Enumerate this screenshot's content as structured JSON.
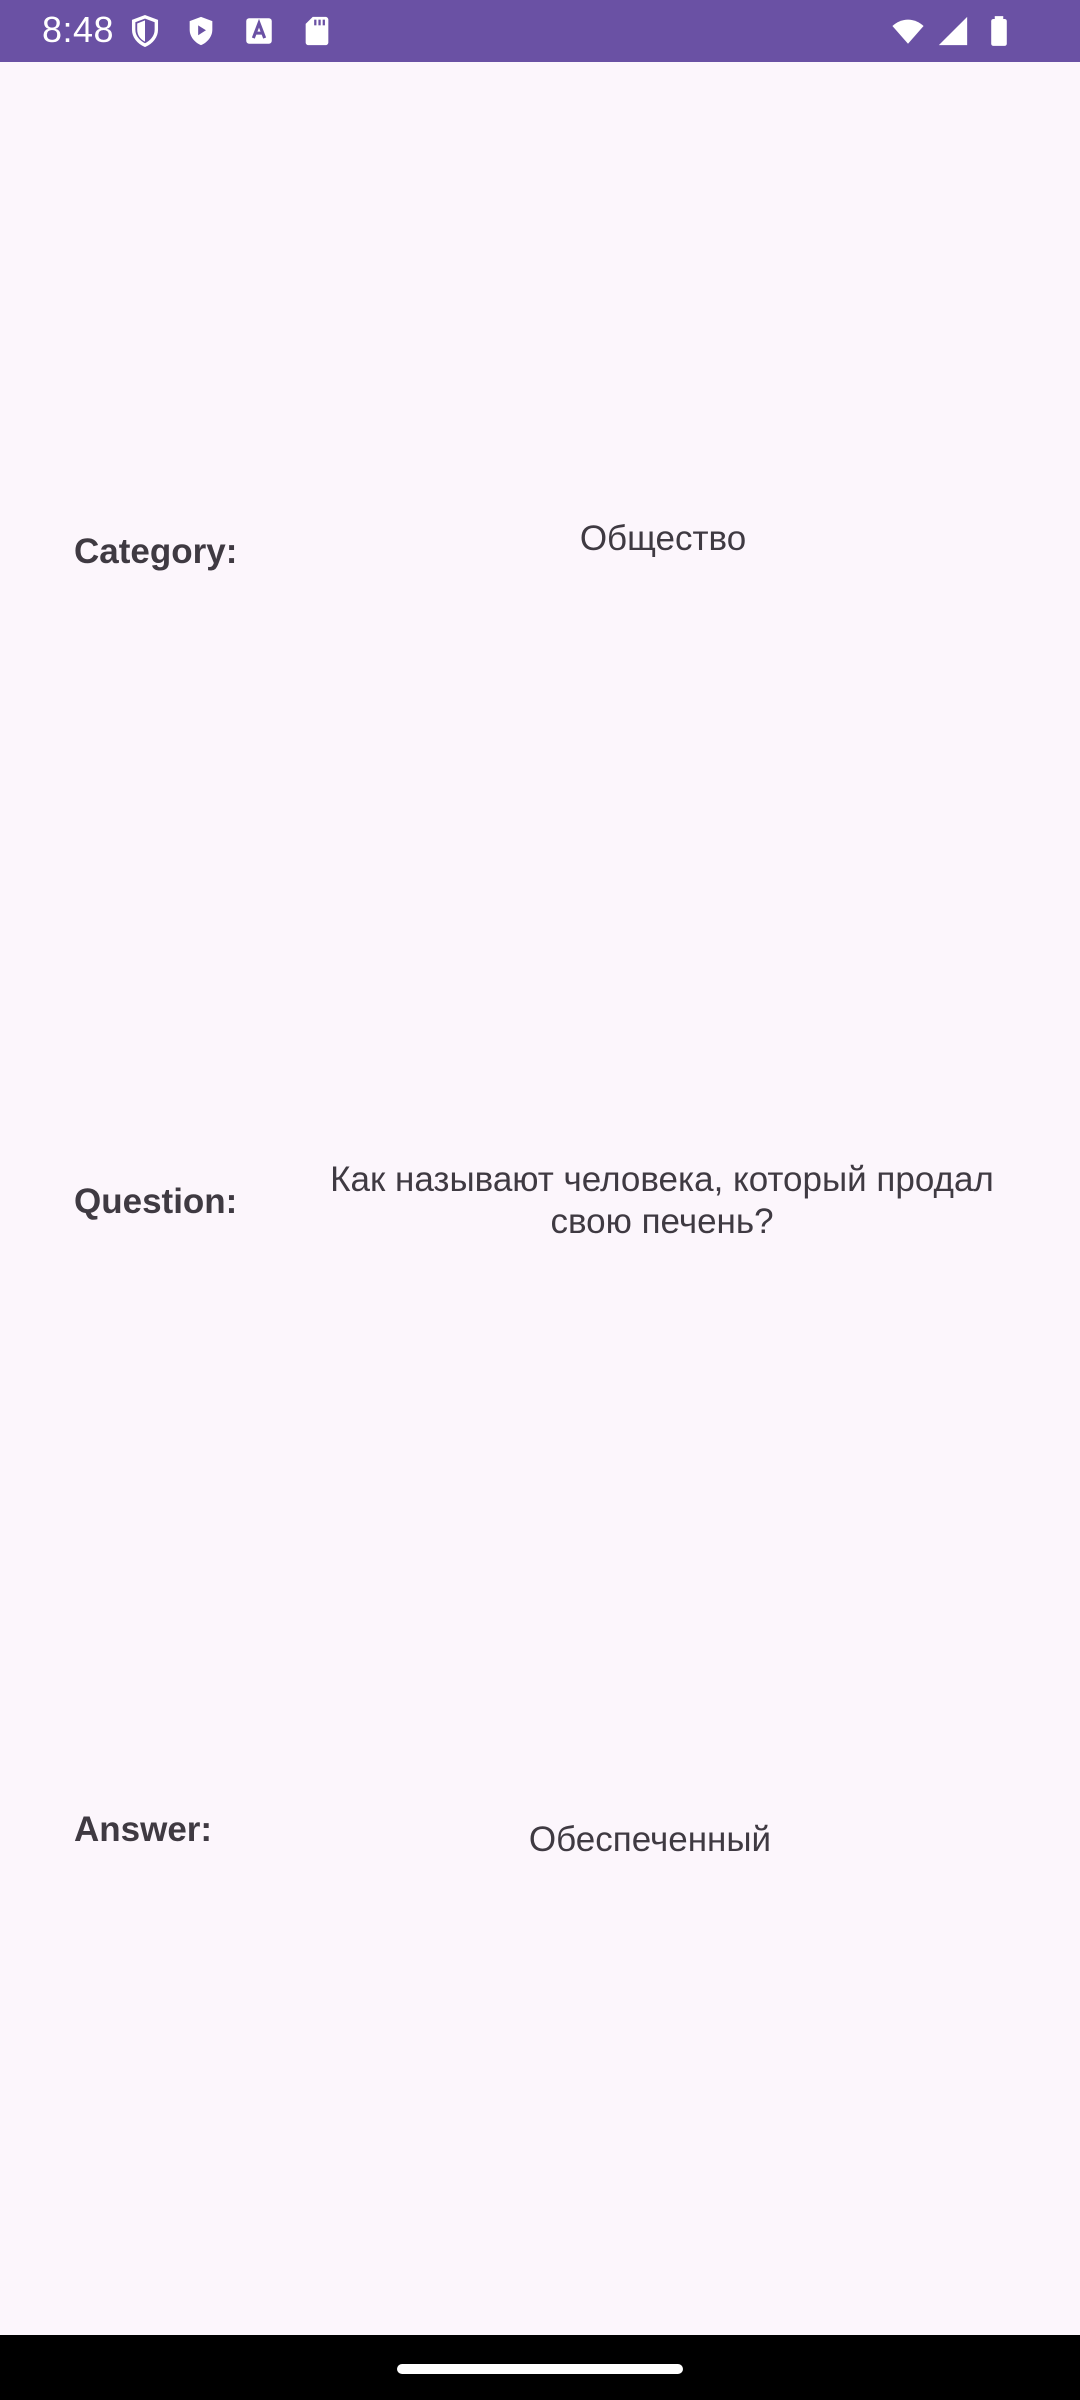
{
  "status_bar": {
    "time": "8:48",
    "left_icons": [
      "shield-icon",
      "play-protect-icon",
      "font-a-icon",
      "sd-card-icon"
    ],
    "right_icons": [
      "wifi-icon",
      "signal-icon",
      "battery-icon"
    ],
    "background_color": "#6A51A4"
  },
  "fields": {
    "category": {
      "label": "Category:",
      "value": "Общество"
    },
    "question": {
      "label": "Question:",
      "value": "Как называют человека, который продал свою печень?"
    },
    "answer": {
      "label": "Answer:",
      "value": "Обеспеченный"
    }
  },
  "colors": {
    "background": "#FCF6FC",
    "text": "#3F3A42",
    "nav_bar": "#000000"
  }
}
